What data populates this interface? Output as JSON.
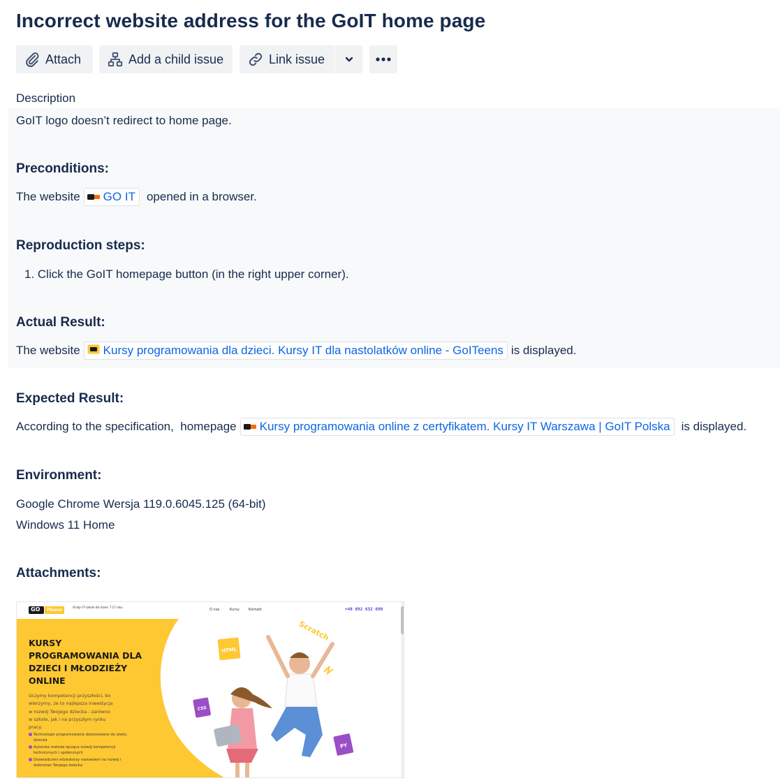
{
  "issue": {
    "title": "Incorrect website address for the GoIT home page"
  },
  "toolbar": {
    "attach_label": "Attach",
    "child_label": "Add a child issue",
    "link_label": "Link issue"
  },
  "description": {
    "label": "Description",
    "summary": "GoIT logo doesn’t redirect to home page.",
    "preconditions": {
      "heading": "Preconditions:",
      "prefix": "The website",
      "link": "GO IT",
      "suffix": "opened in a browser."
    },
    "steps": {
      "heading": "Reproduction steps:",
      "items": [
        "1. Click the GoIT homepage button (in the right upper corner)."
      ]
    },
    "actual": {
      "heading": "Actual Result:",
      "prefix": "The website",
      "link": "Kursy programowania dla dzieci. Kursy IT dla nastolatków online - GoITeens",
      "suffix": "is displayed."
    },
    "expected": {
      "heading": "Expected Result:",
      "prefix": "According to the specification,  homepage",
      "link": "Kursy programowania online z certyfikatem. Kursy IT Warszawa | GoIT Polska",
      "suffix": "is displayed."
    },
    "environment": {
      "heading": "Environment:",
      "lines": [
        "Google Chrome Wersja 119.0.6045.125 (64-bit)",
        "Windows 11 Home"
      ]
    },
    "attachments": {
      "heading": "Attachments:"
    }
  },
  "screenshot": {
    "logo_go": "GO",
    "logo_teens": "iTeens",
    "tagline": "Onlajn IT-szkoła dla dzieci 7-17 roku",
    "nav": [
      "O nas",
      "Kursy",
      "Kontakt"
    ],
    "phone": "+48 692 632 690",
    "hero_title": [
      "KURSY",
      "PROGRAMOWANIA DLA",
      "DZIECI I MŁODZIEŻY",
      "ONLINE"
    ],
    "hero_text": [
      "Uczymy kompetencji przyszłości, bo",
      "wierzymy, że to najlepsza inwestycja",
      "w rozwój Twojego dziecka - zarówno",
      "w szkole, jak i na przyszłym rynku",
      "pracy."
    ],
    "bullets": [
      [
        "Technologie programowania dostosowane do wieku",
        "dziecka"
      ],
      [
        "Autorska metoda łącząca rozwój kompetencji",
        "technicznych i społecznych"
      ],
      [
        "Doświadczeni edukatorzy nastawieni na rozwój i",
        "dobrostan Twojego dziecka"
      ]
    ],
    "tags": [
      "HTML",
      "CSS",
      "PY",
      "Scratch"
    ]
  },
  "colors": {
    "text": "#172b4d",
    "link": "#0c66e4",
    "button_bg": "#f1f2f4",
    "panel_bg": "#f8f9fa",
    "hero_yellow": "#fec832",
    "tag_purple": "#9b4fc6",
    "goiteens_red": "#e55d2b"
  },
  "icons": [
    "paperclip-icon",
    "hierarchy-icon",
    "link-icon",
    "chevron-down-icon",
    "more-icon"
  ]
}
